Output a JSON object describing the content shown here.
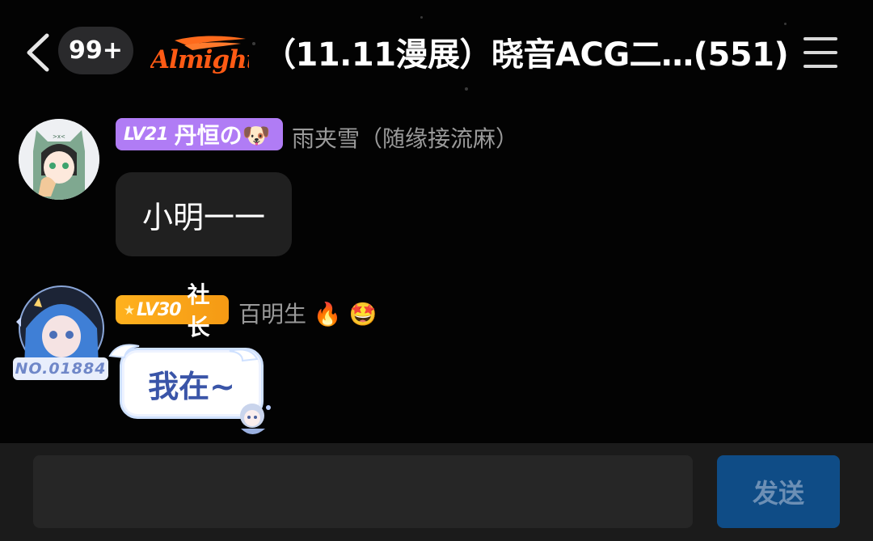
{
  "header": {
    "back_icon": "chevron-left-icon",
    "unread_badge": "99+",
    "logo_text": "Almighty",
    "title": "（11.11漫展）晓音ACG二…(551)",
    "menu_icon": "hamburger-menu-icon"
  },
  "messages": [
    {
      "level": "LV21",
      "badge_name": "丹恒の🐶",
      "badge_color": "#b07cf5",
      "sender": "雨夹雪（随缘接流麻）",
      "text": "小明一一"
    },
    {
      "level": "LV30",
      "badge_name": "社长",
      "badge_color": "#f7a21a",
      "sender": "百明生 🔥 🤩",
      "avatar_frame_text": "NO.01884",
      "text": "我在~"
    }
  ],
  "composer": {
    "input_value": "",
    "input_placeholder": "",
    "send_label": "发送"
  }
}
